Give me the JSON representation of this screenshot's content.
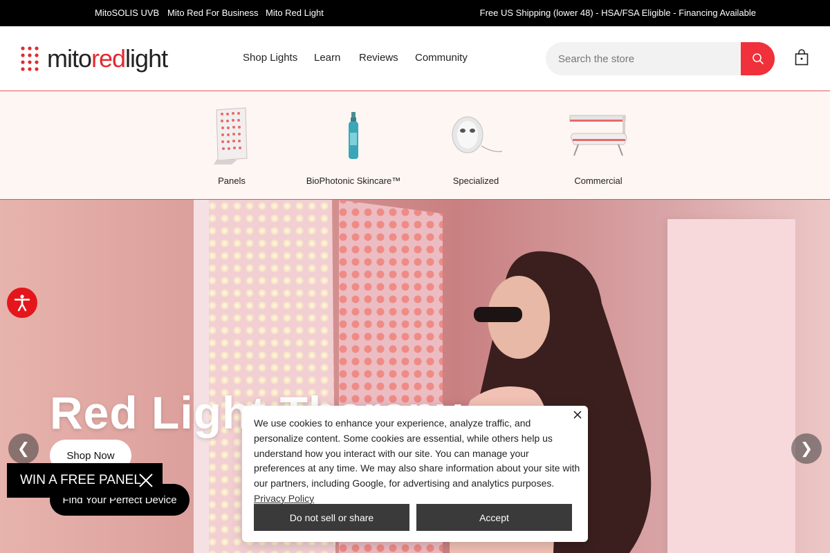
{
  "topbar": {
    "links": [
      "MitoSOLIS UVB",
      "Mito Red For Business",
      "Mito Red Light"
    ],
    "promo": "Free US Shipping (lower 48) - HSA/FSA Eligible - Financing Available"
  },
  "header": {
    "logo_prefix": "mito",
    "logo_red": "red",
    "logo_suffix": "light",
    "nav": [
      "Shop Lights",
      "Learn",
      "Reviews",
      "Community"
    ],
    "search_placeholder": "Search the store"
  },
  "categories": [
    "Panels",
    "BioPhotonic Skincare™",
    "Specialized",
    "Commercial"
  ],
  "hero": {
    "title": "Red Light Therapy",
    "shop_now": "Shop Now",
    "find_device": "Find Your Perfect Device",
    "prev_arrow": "❮",
    "next_arrow": "❯"
  },
  "win_panel": {
    "label": "WIN A FREE PANEL"
  },
  "cookie": {
    "text": "We use cookies to enhance your experience, analyze traffic, and personalize content. Some cookies are essential, while others help us understand how you interact with our site. You can manage your preferences at any time. We may also share information about your site with our partners, including Google, for advertising and analytics purposes.",
    "link": "Privacy Policy",
    "decline": "Do not sell or share",
    "accept": "Accept"
  },
  "colors": {
    "brand_red": "#e22a2f",
    "search_button": "#f0303a",
    "accessibility": "#e4161c"
  },
  "icons": [
    "search-icon",
    "cart-icon",
    "accessibility-icon",
    "close-icon",
    "chevron-left-icon",
    "chevron-right-icon"
  ]
}
